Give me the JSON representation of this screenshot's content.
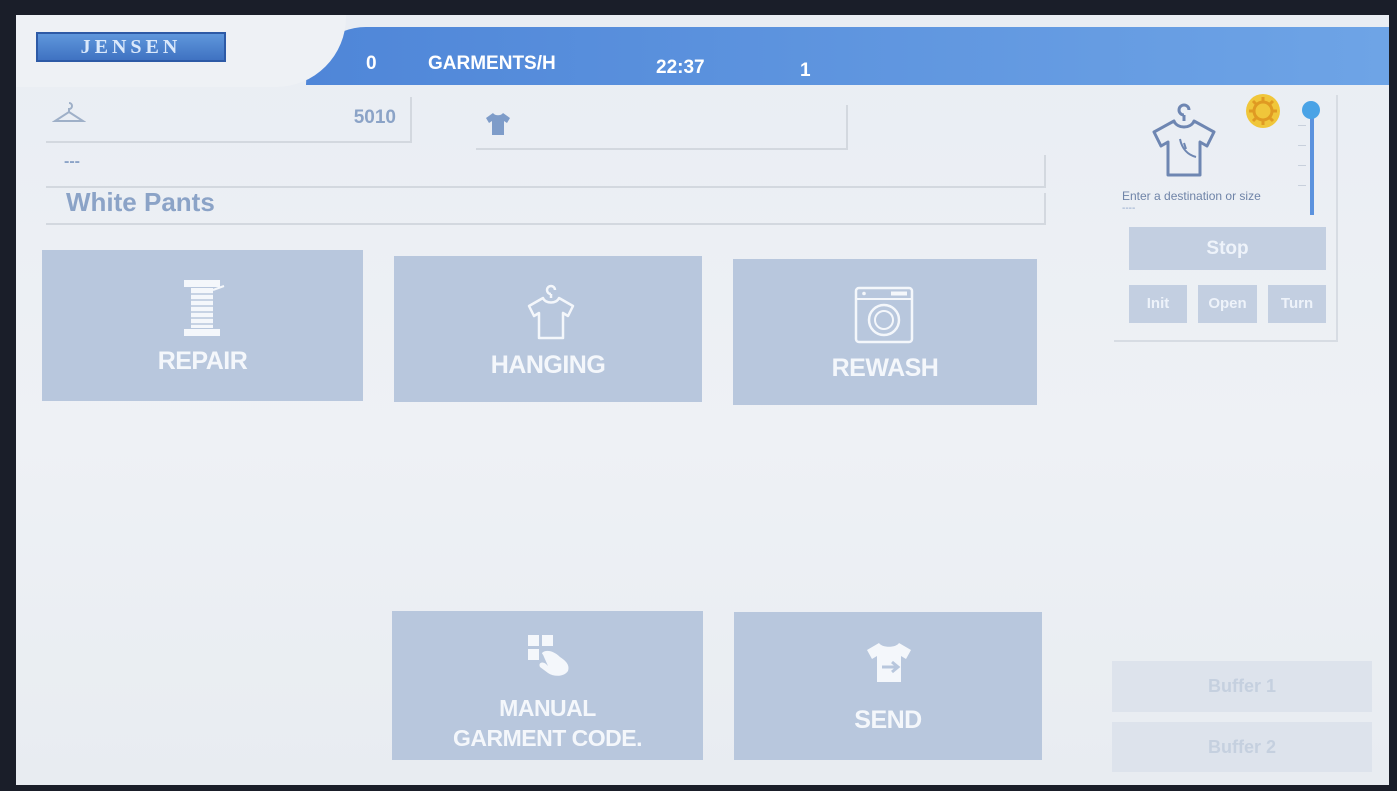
{
  "header": {
    "logo_text": "JENSEN",
    "count": "0",
    "rate_label": "GARMENTS/H",
    "time": "22:37",
    "station": "1"
  },
  "fields": {
    "hanger_value": "5010",
    "dashes": "---",
    "product_name": "White Pants"
  },
  "tiles": {
    "repair": "REPAIR",
    "hanging": "HANGING",
    "rewash": "REWASH",
    "manual_line1": "MANUAL",
    "manual_line2": "GARMENT CODE.",
    "send": "SEND"
  },
  "panel": {
    "destination_placeholder": "Enter a destination or size",
    "dashes": "----",
    "stop": "Stop",
    "init": "Init",
    "open": "Open",
    "turn": "Turn"
  },
  "buffers": {
    "buffer1": "Buffer 1",
    "buffer2": "Buffer 2"
  },
  "icons": {
    "settings": "gear-icon",
    "hanger": "hanger-icon",
    "shirt": "shirt-icon",
    "repair": "thread-spool-icon",
    "hanging": "hanger-shirt-icon",
    "rewash": "washing-machine-icon",
    "manual": "hand-keypad-icon",
    "send": "shirt-arrow-icon"
  },
  "colors": {
    "header_blue": "#5b92de",
    "tile": "#b8c7dd",
    "gear": "#f0c63a"
  },
  "slider_level": 1.0
}
